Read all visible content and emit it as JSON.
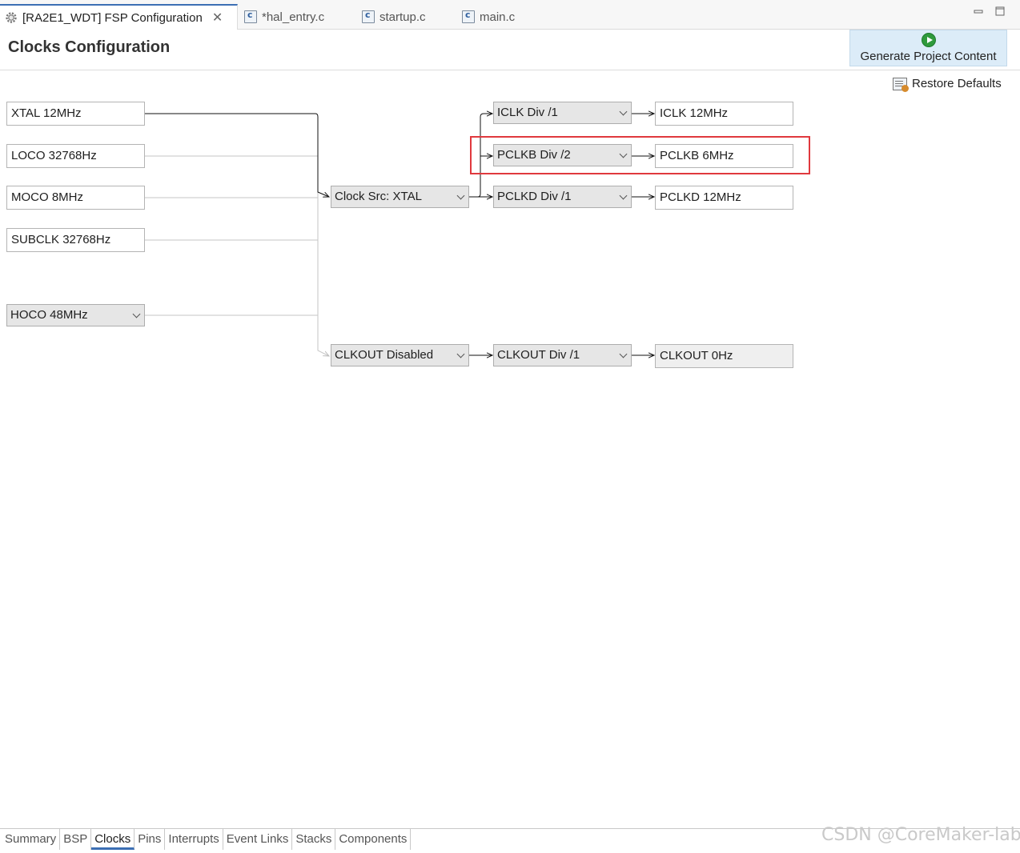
{
  "tabs": [
    {
      "label": "[RA2E1_WDT] FSP Configuration",
      "icon": "gear-icon",
      "active": true
    },
    {
      "label": "*hal_entry.c",
      "icon": "c-file-icon"
    },
    {
      "label": "startup.c",
      "icon": "c-file-icon"
    },
    {
      "label": "main.c",
      "icon": "c-file-icon"
    }
  ],
  "header": {
    "title": "Clocks Configuration",
    "generate_label": "Generate Project Content",
    "restore_label": "Restore Defaults"
  },
  "sources": {
    "xtal": "XTAL 12MHz",
    "loco": "LOCO 32768Hz",
    "moco": "MOCO 8MHz",
    "subclk": "SUBCLK 32768Hz",
    "hoco": "HOCO 48MHz"
  },
  "clock_src": "Clock Src: XTAL",
  "clkout_src": "CLKOUT Disabled",
  "dividers": {
    "iclk": "ICLK Div /1",
    "pclkb": "PCLKB Div /2",
    "pclkd": "PCLKD Div /1",
    "clkout": "CLKOUT Div /1"
  },
  "outputs": {
    "iclk": "ICLK 12MHz",
    "pclkb": "PCLKB 6MHz",
    "pclkd": "PCLKD 12MHz",
    "clkout": "CLKOUT 0Hz"
  },
  "bottom_tabs": [
    "Summary",
    "BSP",
    "Clocks",
    "Pins",
    "Interrupts",
    "Event Links",
    "Stacks",
    "Components"
  ],
  "bottom_active": "Clocks",
  "watermark": "CSDN @CoreMaker-lab",
  "colors": {
    "highlight": "#e0393e",
    "accent": "#3c6fb4",
    "generate_bg": "#dcecf8"
  }
}
